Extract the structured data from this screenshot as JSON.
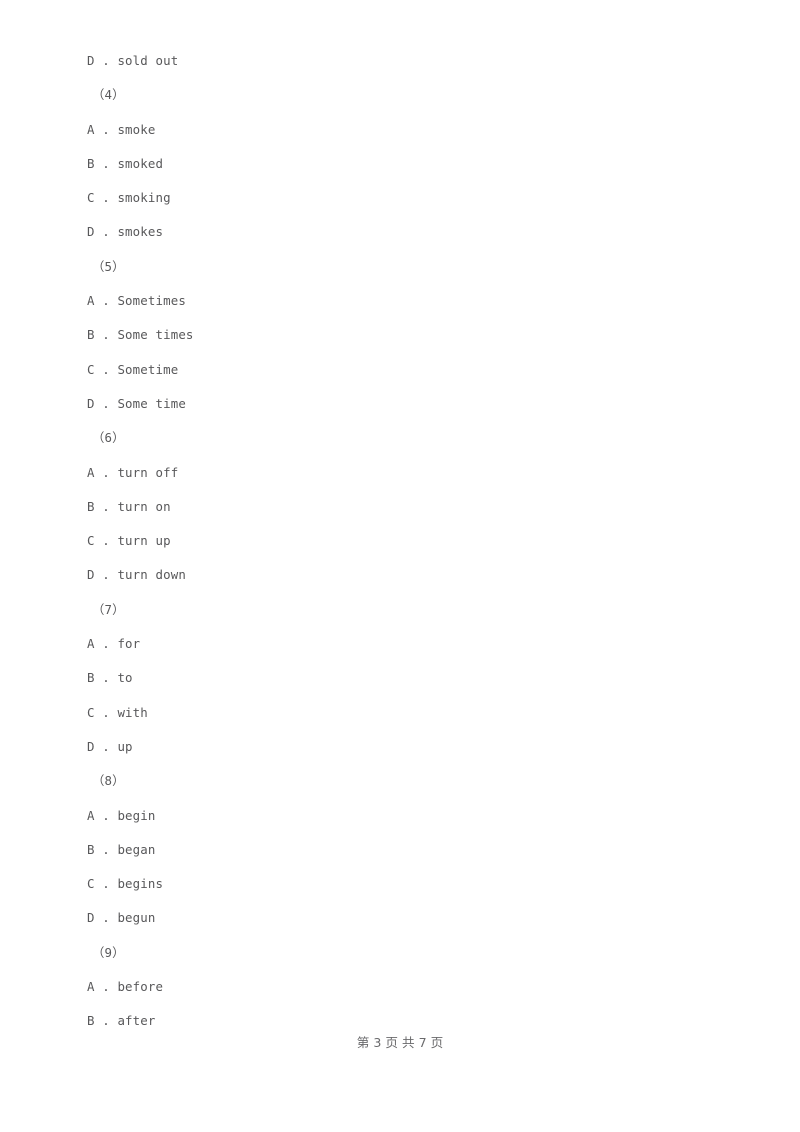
{
  "document": {
    "page_footer": "第 3 页 共 7 页",
    "current_page": "3",
    "total_pages": "7",
    "text_color": "#58585a"
  },
  "lines": [
    {
      "kind": "option",
      "text": "D . sold out"
    },
    {
      "kind": "qnum",
      "text": "（4）"
    },
    {
      "kind": "option",
      "text": "A . smoke"
    },
    {
      "kind": "option",
      "text": "B . smoked"
    },
    {
      "kind": "option",
      "text": "C . smoking"
    },
    {
      "kind": "option",
      "text": "D . smokes"
    },
    {
      "kind": "qnum",
      "text": "（5）"
    },
    {
      "kind": "option",
      "text": "A . Sometimes"
    },
    {
      "kind": "option",
      "text": "B . Some times"
    },
    {
      "kind": "option",
      "text": "C . Sometime"
    },
    {
      "kind": "option",
      "text": "D . Some time"
    },
    {
      "kind": "qnum",
      "text": "（6）"
    },
    {
      "kind": "option",
      "text": "A . turn off"
    },
    {
      "kind": "option",
      "text": "B . turn on"
    },
    {
      "kind": "option",
      "text": "C . turn up"
    },
    {
      "kind": "option",
      "text": "D . turn down"
    },
    {
      "kind": "qnum",
      "text": "（7）"
    },
    {
      "kind": "option",
      "text": "A . for"
    },
    {
      "kind": "option",
      "text": "B . to"
    },
    {
      "kind": "option",
      "text": "C . with"
    },
    {
      "kind": "option",
      "text": "D . up"
    },
    {
      "kind": "qnum",
      "text": "（8）"
    },
    {
      "kind": "option",
      "text": "A . begin"
    },
    {
      "kind": "option",
      "text": "B . began"
    },
    {
      "kind": "option",
      "text": "C . begins"
    },
    {
      "kind": "option",
      "text": "D . begun"
    },
    {
      "kind": "qnum",
      "text": "（9）"
    },
    {
      "kind": "option",
      "text": "A . before"
    },
    {
      "kind": "option",
      "text": "B . after"
    }
  ]
}
